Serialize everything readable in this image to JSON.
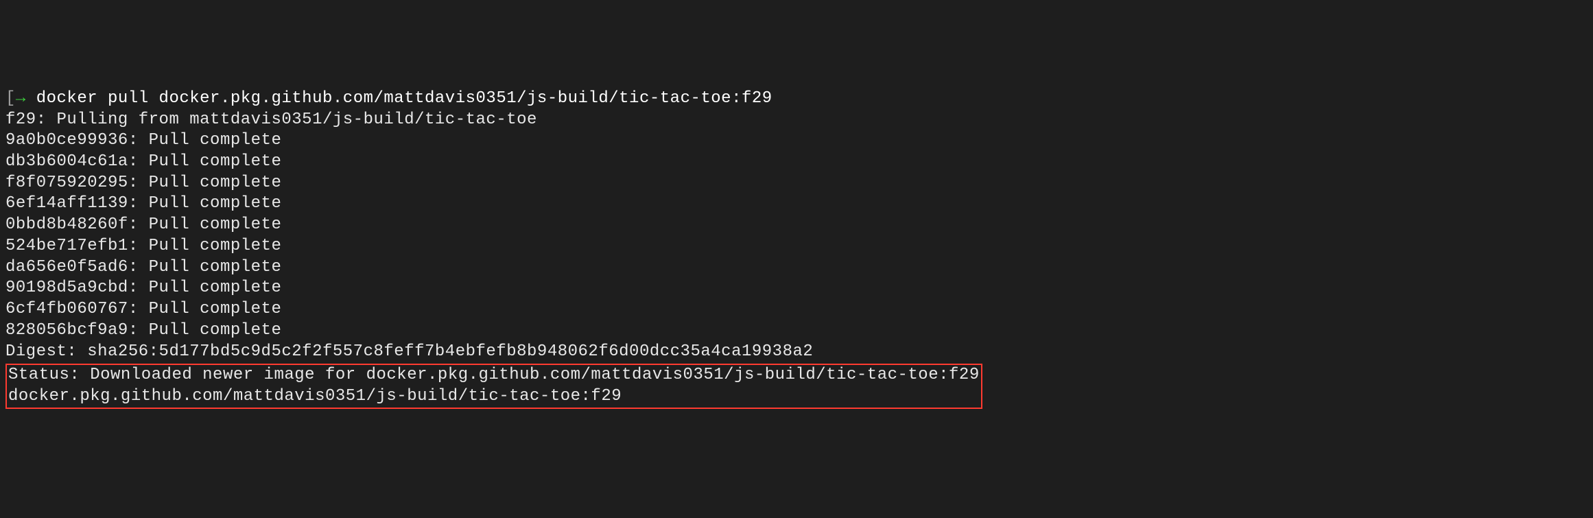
{
  "prompt": {
    "bracket": "[",
    "arrow": "→"
  },
  "command": " docker pull docker.pkg.github.com/mattdavis0351/js-build/tic-tac-toe:f29",
  "pulling_line": "f29: Pulling from mattdavis0351/js-build/tic-tac-toe",
  "layers": [
    "9a0b0ce99936: Pull complete",
    "db3b6004c61a: Pull complete",
    "f8f075920295: Pull complete",
    "6ef14aff1139: Pull complete",
    "0bbd8b48260f: Pull complete",
    "524be717efb1: Pull complete",
    "da656e0f5ad6: Pull complete",
    "90198d5a9cbd: Pull complete",
    "6cf4fb060767: Pull complete",
    "828056bcf9a9: Pull complete"
  ],
  "digest": "Digest: sha256:5d177bd5c9d5c2f2f557c8feff7b4ebfefb8b948062f6d00dcc35a4ca19938a2",
  "status": "Status: Downloaded newer image for docker.pkg.github.com/mattdavis0351/js-build/tic-tac-toe:f29",
  "image_ref": "docker.pkg.github.com/mattdavis0351/js-build/tic-tac-toe:f29"
}
